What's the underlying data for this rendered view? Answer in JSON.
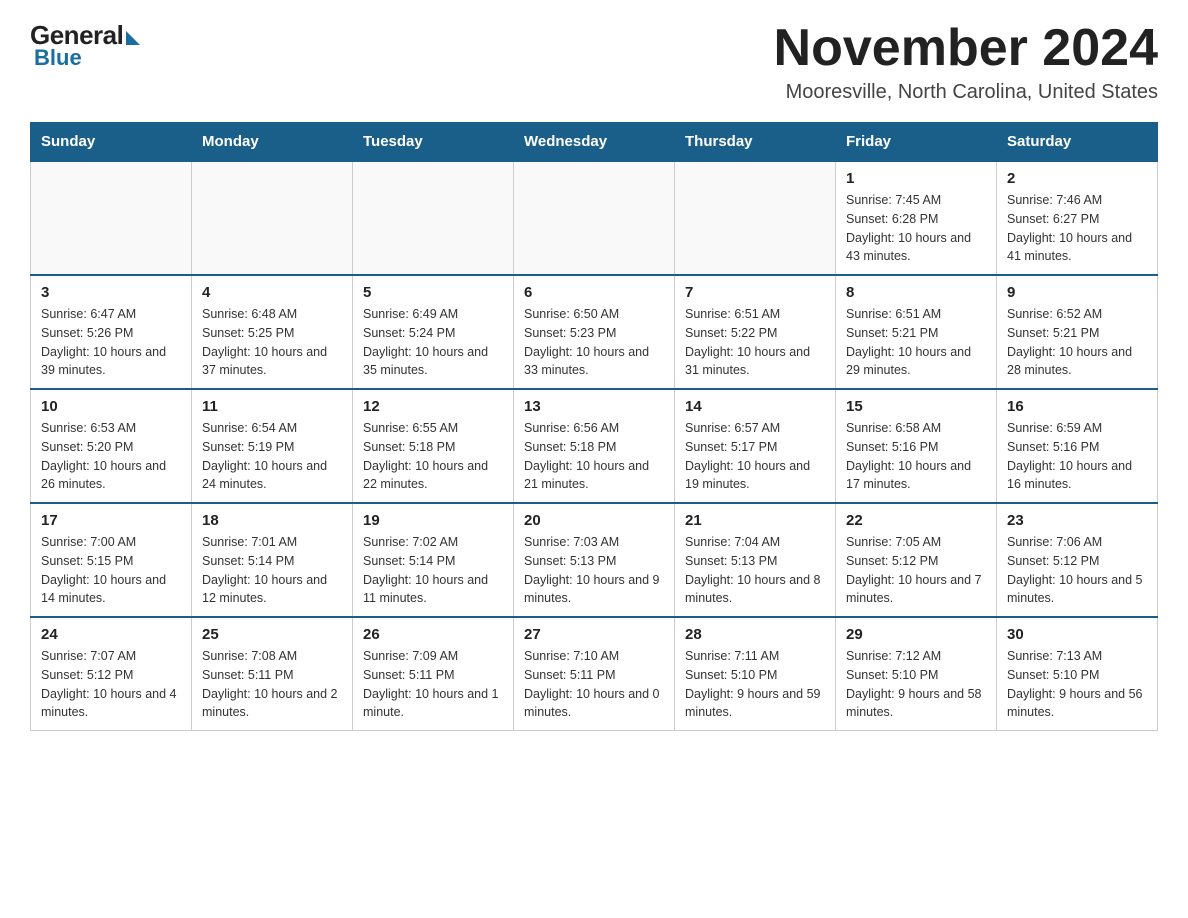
{
  "logo": {
    "general": "General",
    "blue": "Blue"
  },
  "title": "November 2024",
  "subtitle": "Mooresville, North Carolina, United States",
  "days_of_week": [
    "Sunday",
    "Monday",
    "Tuesday",
    "Wednesday",
    "Thursday",
    "Friday",
    "Saturday"
  ],
  "weeks": [
    [
      {
        "day": "",
        "info": ""
      },
      {
        "day": "",
        "info": ""
      },
      {
        "day": "",
        "info": ""
      },
      {
        "day": "",
        "info": ""
      },
      {
        "day": "",
        "info": ""
      },
      {
        "day": "1",
        "info": "Sunrise: 7:45 AM\nSunset: 6:28 PM\nDaylight: 10 hours and 43 minutes."
      },
      {
        "day": "2",
        "info": "Sunrise: 7:46 AM\nSunset: 6:27 PM\nDaylight: 10 hours and 41 minutes."
      }
    ],
    [
      {
        "day": "3",
        "info": "Sunrise: 6:47 AM\nSunset: 5:26 PM\nDaylight: 10 hours and 39 minutes."
      },
      {
        "day": "4",
        "info": "Sunrise: 6:48 AM\nSunset: 5:25 PM\nDaylight: 10 hours and 37 minutes."
      },
      {
        "day": "5",
        "info": "Sunrise: 6:49 AM\nSunset: 5:24 PM\nDaylight: 10 hours and 35 minutes."
      },
      {
        "day": "6",
        "info": "Sunrise: 6:50 AM\nSunset: 5:23 PM\nDaylight: 10 hours and 33 minutes."
      },
      {
        "day": "7",
        "info": "Sunrise: 6:51 AM\nSunset: 5:22 PM\nDaylight: 10 hours and 31 minutes."
      },
      {
        "day": "8",
        "info": "Sunrise: 6:51 AM\nSunset: 5:21 PM\nDaylight: 10 hours and 29 minutes."
      },
      {
        "day": "9",
        "info": "Sunrise: 6:52 AM\nSunset: 5:21 PM\nDaylight: 10 hours and 28 minutes."
      }
    ],
    [
      {
        "day": "10",
        "info": "Sunrise: 6:53 AM\nSunset: 5:20 PM\nDaylight: 10 hours and 26 minutes."
      },
      {
        "day": "11",
        "info": "Sunrise: 6:54 AM\nSunset: 5:19 PM\nDaylight: 10 hours and 24 minutes."
      },
      {
        "day": "12",
        "info": "Sunrise: 6:55 AM\nSunset: 5:18 PM\nDaylight: 10 hours and 22 minutes."
      },
      {
        "day": "13",
        "info": "Sunrise: 6:56 AM\nSunset: 5:18 PM\nDaylight: 10 hours and 21 minutes."
      },
      {
        "day": "14",
        "info": "Sunrise: 6:57 AM\nSunset: 5:17 PM\nDaylight: 10 hours and 19 minutes."
      },
      {
        "day": "15",
        "info": "Sunrise: 6:58 AM\nSunset: 5:16 PM\nDaylight: 10 hours and 17 minutes."
      },
      {
        "day": "16",
        "info": "Sunrise: 6:59 AM\nSunset: 5:16 PM\nDaylight: 10 hours and 16 minutes."
      }
    ],
    [
      {
        "day": "17",
        "info": "Sunrise: 7:00 AM\nSunset: 5:15 PM\nDaylight: 10 hours and 14 minutes."
      },
      {
        "day": "18",
        "info": "Sunrise: 7:01 AM\nSunset: 5:14 PM\nDaylight: 10 hours and 12 minutes."
      },
      {
        "day": "19",
        "info": "Sunrise: 7:02 AM\nSunset: 5:14 PM\nDaylight: 10 hours and 11 minutes."
      },
      {
        "day": "20",
        "info": "Sunrise: 7:03 AM\nSunset: 5:13 PM\nDaylight: 10 hours and 9 minutes."
      },
      {
        "day": "21",
        "info": "Sunrise: 7:04 AM\nSunset: 5:13 PM\nDaylight: 10 hours and 8 minutes."
      },
      {
        "day": "22",
        "info": "Sunrise: 7:05 AM\nSunset: 5:12 PM\nDaylight: 10 hours and 7 minutes."
      },
      {
        "day": "23",
        "info": "Sunrise: 7:06 AM\nSunset: 5:12 PM\nDaylight: 10 hours and 5 minutes."
      }
    ],
    [
      {
        "day": "24",
        "info": "Sunrise: 7:07 AM\nSunset: 5:12 PM\nDaylight: 10 hours and 4 minutes."
      },
      {
        "day": "25",
        "info": "Sunrise: 7:08 AM\nSunset: 5:11 PM\nDaylight: 10 hours and 2 minutes."
      },
      {
        "day": "26",
        "info": "Sunrise: 7:09 AM\nSunset: 5:11 PM\nDaylight: 10 hours and 1 minute."
      },
      {
        "day": "27",
        "info": "Sunrise: 7:10 AM\nSunset: 5:11 PM\nDaylight: 10 hours and 0 minutes."
      },
      {
        "day": "28",
        "info": "Sunrise: 7:11 AM\nSunset: 5:10 PM\nDaylight: 9 hours and 59 minutes."
      },
      {
        "day": "29",
        "info": "Sunrise: 7:12 AM\nSunset: 5:10 PM\nDaylight: 9 hours and 58 minutes."
      },
      {
        "day": "30",
        "info": "Sunrise: 7:13 AM\nSunset: 5:10 PM\nDaylight: 9 hours and 56 minutes."
      }
    ]
  ]
}
